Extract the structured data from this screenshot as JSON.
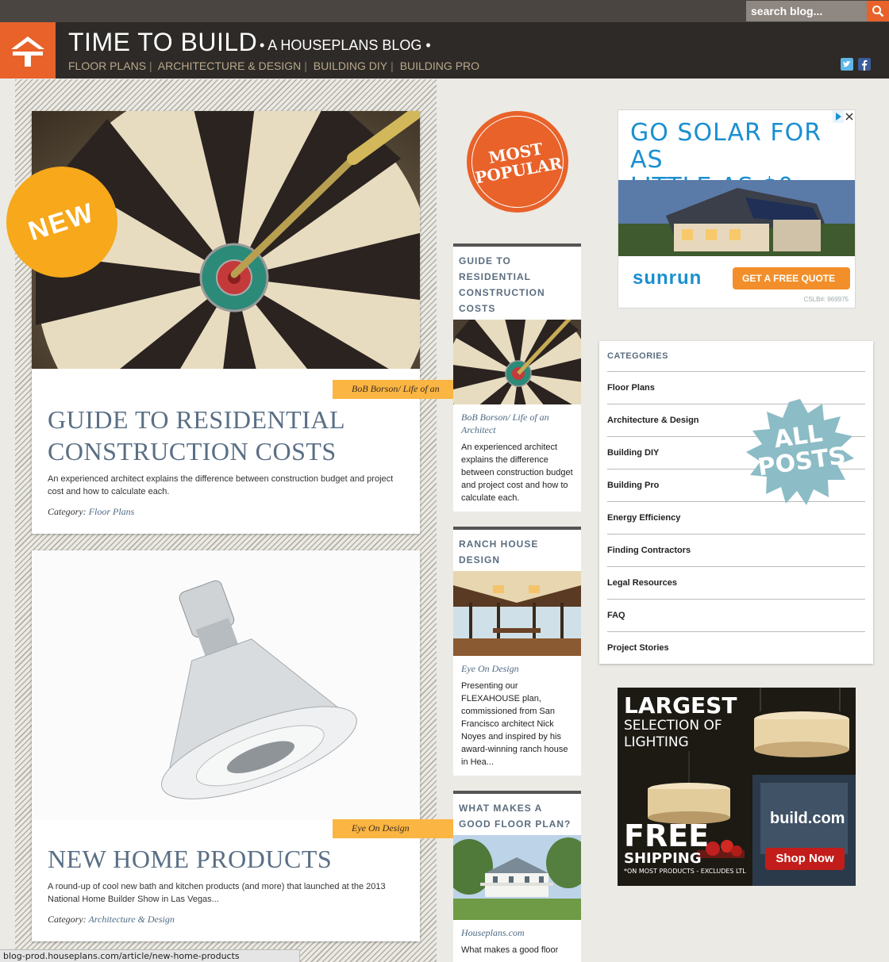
{
  "search": {
    "placeholder": "search blog..."
  },
  "header": {
    "title": "TIME TO BUILD",
    "subtitle": "• A HOUSEPLANS BLOG •",
    "nav": [
      "FLOOR PLANS",
      "ARCHITECTURE & DESIGN",
      "BUILDING DIY",
      "BUILDING PRO"
    ]
  },
  "badges": {
    "new": "NEW",
    "most_popular_line1": "MOST",
    "most_popular_line2": "POPULAR",
    "all_posts_line1": "ALL",
    "all_posts_line2": "POSTS"
  },
  "articles": [
    {
      "author": "BoB Borson/ Life of an",
      "title_line1": "GUIDE TO RESIDENTIAL",
      "title_line2": "CONSTRUCTION COSTS",
      "description": "An experienced architect explains the difference between construction budget and project cost and how to calculate each.",
      "category_label": "Category:",
      "category": "Floor Plans"
    },
    {
      "author": "Eye On Design",
      "title_line1": "NEW HOME PRODUCTS",
      "title_line2": "",
      "description": "A round-up of cool new bath and kitchen products (and more) that launched at the 2013 National Home Builder Show in Las Vegas...",
      "category_label": "Category:",
      "category": "Architecture & Design"
    }
  ],
  "popular": [
    {
      "title": "GUIDE TO RESIDENTIAL CONSTRUCTION COSTS",
      "author": "BoB Borson/ Life of an Architect",
      "description": "An experienced architect explains the difference between construction budget and project cost and how to calculate each."
    },
    {
      "title": "RANCH HOUSE DESIGN",
      "author": "Eye On Design",
      "description": "Presenting our FLEXAHOUSE plan, commissioned from San Francisco architect Nick Noyes and inspired by his award-winning ranch house in Hea..."
    },
    {
      "title": "WHAT MAKES A GOOD FLOOR PLAN?",
      "author": "Houseplans.com",
      "description": "What makes a good floor"
    }
  ],
  "ads": {
    "solar_headline_line1": "GO SOLAR FOR AS",
    "solar_headline_line2": "LITTLE AS $0",
    "solar_brand": "sunrun",
    "solar_cta": "GET A FREE QUOTE",
    "solar_license": "CSLB#: 969975",
    "build_line1": "LARGEST",
    "build_line2": "SELECTION OF",
    "build_line3": "LIGHTING",
    "build_free": "FREE",
    "build_shipping": "SHIPPING",
    "build_note": "*ON MOST PRODUCTS - EXCLUDES LTL",
    "build_brand": "build.com",
    "build_cta": "Shop Now"
  },
  "categories": {
    "heading": "CATEGORIES",
    "items": [
      "Floor Plans",
      "Architecture & Design",
      "Building DIY",
      "Building Pro",
      "Energy Efficiency",
      "Finding Contractors",
      "Legal Resources",
      "FAQ",
      "Project Stories"
    ]
  },
  "status_url": "blog-prod.houseplans.com/article/new-home-products",
  "colors": {
    "accent_orange": "#e8622a",
    "badge_yellow": "#f7a81b",
    "title_blue": "#5a6f85",
    "header_dark": "#2e2a27"
  }
}
